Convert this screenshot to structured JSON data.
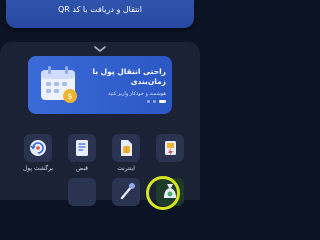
{
  "top_banner": {
    "text": "انتقال و دریافت با کد QR"
  },
  "promo": {
    "title": "راحتی انتقال پول با زمان‌بندی",
    "subtitle": "هوشمند و خودکار واریز کنید",
    "slides_total": 3,
    "active_slide": 1
  },
  "services": [
    {
      "label": "برگشت پول",
      "icon": "refund-icon"
    },
    {
      "label": "قبض",
      "icon": "bill-icon"
    },
    {
      "label": "اینترنت",
      "icon": "internet-sim-icon"
    },
    {
      "label": "",
      "icon": "charge-icon"
    }
  ],
  "colors": {
    "accent": "#2f54ae",
    "highlight": "#d8e51c",
    "background": "#0c1324",
    "sheet": "#1b2236"
  }
}
